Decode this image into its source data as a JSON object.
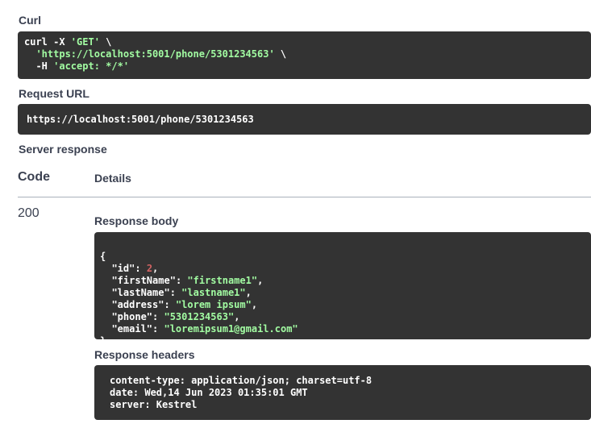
{
  "curl": {
    "label": "Curl",
    "line1_cmd": "curl -X ",
    "line1_method": "'GET'",
    "line1_tail": " \\",
    "line2_indent": "  ",
    "line2_url": "'https://localhost:5001/phone/5301234563'",
    "line2_tail": " \\",
    "line3_prefix": "  -H ",
    "line3_header": "'accept: */*'"
  },
  "request_url": {
    "label": "Request URL",
    "value": "https://localhost:5001/phone/5301234563"
  },
  "server_response": {
    "label": "Server response",
    "code_header": "Code",
    "details_header": "Details",
    "status_code": "200"
  },
  "response_body": {
    "label": "Response body",
    "open": "{",
    "close": "}",
    "fields": [
      {
        "key": "\"id\"",
        "value": "2",
        "type": "num",
        "comma": ","
      },
      {
        "key": "\"firstName\"",
        "value": "\"firstname1\"",
        "type": "str",
        "comma": ","
      },
      {
        "key": "\"lastName\"",
        "value": "\"lastname1\"",
        "type": "str",
        "comma": ","
      },
      {
        "key": "\"address\"",
        "value": "\"lorem ipsum\"",
        "type": "str",
        "comma": ","
      },
      {
        "key": "\"phone\"",
        "value": "\"5301234563\"",
        "type": "str",
        "comma": ","
      },
      {
        "key": "\"email\"",
        "value": "\"loremipsum1@gmail.com\"",
        "type": "str",
        "comma": ""
      }
    ]
  },
  "response_headers": {
    "label": "Response headers",
    "lines": [
      "content-type: application/json; charset=utf-8",
      "date: Wed,14 Jun 2023 01:35:01 GMT",
      "server: Kestrel"
    ]
  },
  "colors": {
    "code_bg": "#333333",
    "string": "#a2fca2",
    "number": "#d36363",
    "text": "#3b4151"
  }
}
